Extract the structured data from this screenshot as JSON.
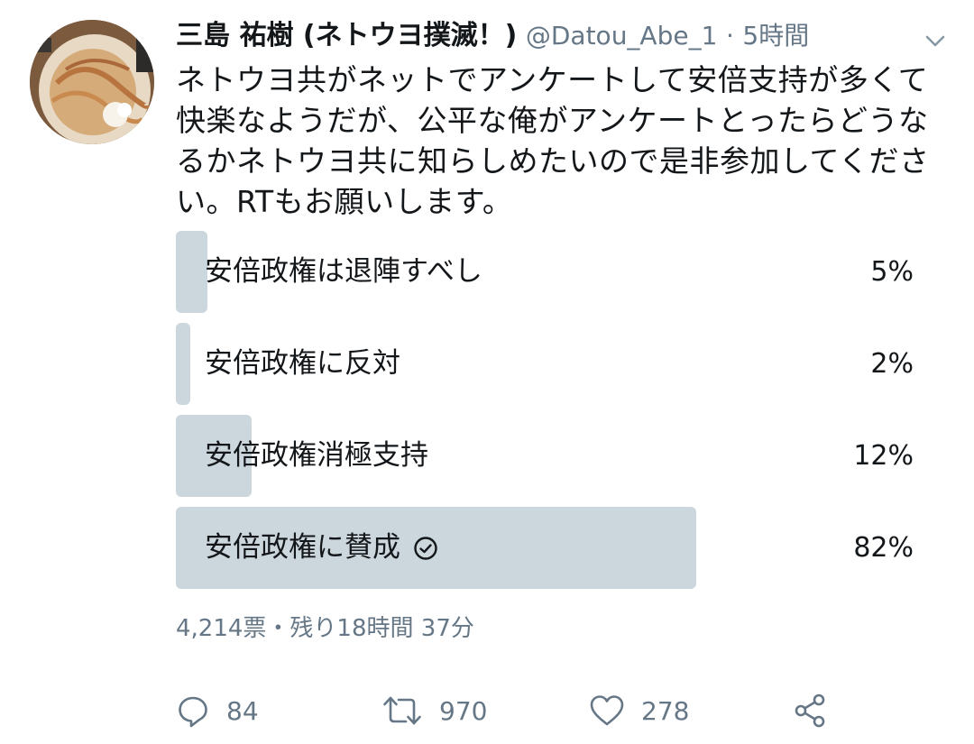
{
  "tweet": {
    "author_name": "三島 祐樹 (ネトウヨ撲滅！)",
    "handle": "@Datou_Abe_1",
    "separator": "·",
    "time": "5時間",
    "text": "ネトウヨ共がネットでアンケートして安倍支持が多くて快楽なようだが、公平な俺がアンケートとったらどうなるかネトウヨ共に知らしめたいので是非参加してください。RTもお願いします。"
  },
  "poll": {
    "options": [
      {
        "label": "安倍政権は退陣すべし",
        "percent_text": "5%",
        "percent": 5,
        "selected": false
      },
      {
        "label": "安倍政権に反対",
        "percent_text": "2%",
        "percent": 2,
        "selected": false
      },
      {
        "label": "安倍政権消極支持",
        "percent_text": "12%",
        "percent": 12,
        "selected": false
      },
      {
        "label": "安倍政権に賛成",
        "percent_text": "82%",
        "percent": 82,
        "selected": true
      }
    ],
    "meta": "4,214票・残り18時間 37分"
  },
  "actions": {
    "reply_count": "84",
    "retweet_count": "970",
    "like_count": "278"
  },
  "icons": {
    "caret": "chevron-down-icon",
    "check": "check-circle-icon",
    "reply": "reply-icon",
    "retweet": "retweet-icon",
    "like": "heart-icon",
    "share": "share-icon"
  },
  "colors": {
    "bar": "#ccd6dd",
    "muted": "#657786",
    "text": "#14171a"
  }
}
